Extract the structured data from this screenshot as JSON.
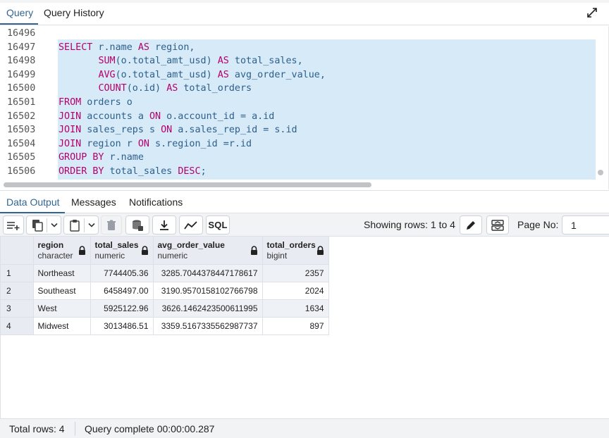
{
  "top_tabs": [
    {
      "label": "Query",
      "active": true
    },
    {
      "label": "Query History",
      "active": false
    }
  ],
  "editor": {
    "line_numbers": [
      "16496",
      "16497",
      "16498",
      "16499",
      "16500",
      "16501",
      "16502",
      "16503",
      "16504",
      "16505",
      "16506"
    ],
    "lines": [
      [],
      [
        {
          "t": "SELECT",
          "k": true
        },
        {
          "t": " r.name "
        },
        {
          "t": "AS",
          "k": true
        },
        {
          "t": " region,"
        }
      ],
      [
        {
          "t": "       "
        },
        {
          "t": "SUM",
          "k": true
        },
        {
          "t": "(o.total_amt_usd) "
        },
        {
          "t": "AS",
          "k": true
        },
        {
          "t": " total_sales,"
        }
      ],
      [
        {
          "t": "       "
        },
        {
          "t": "AVG",
          "k": true
        },
        {
          "t": "(o.total_amt_usd) "
        },
        {
          "t": "AS",
          "k": true
        },
        {
          "t": " avg_order_value,"
        }
      ],
      [
        {
          "t": "       "
        },
        {
          "t": "COUNT",
          "k": true
        },
        {
          "t": "(o.id) "
        },
        {
          "t": "AS",
          "k": true
        },
        {
          "t": " total_orders"
        }
      ],
      [
        {
          "t": "FROM",
          "k": true
        },
        {
          "t": " orders o"
        }
      ],
      [
        {
          "t": "JOIN",
          "k": true
        },
        {
          "t": " accounts a "
        },
        {
          "t": "ON",
          "k": true
        },
        {
          "t": " o.account_id = a.id"
        }
      ],
      [
        {
          "t": "JOIN",
          "k": true
        },
        {
          "t": " sales_reps s "
        },
        {
          "t": "ON",
          "k": true
        },
        {
          "t": " a.sales_rep_id = s.id"
        }
      ],
      [
        {
          "t": "JOIN",
          "k": true
        },
        {
          "t": " region r "
        },
        {
          "t": "ON",
          "k": true
        },
        {
          "t": " s.region_id =r.id"
        }
      ],
      [
        {
          "t": "GROUP BY",
          "k": true
        },
        {
          "t": " r.name"
        }
      ],
      [
        {
          "t": "ORDER BY",
          "k": true
        },
        {
          "t": " total_sales "
        },
        {
          "t": "DESC",
          "k": true
        },
        {
          "t": ";"
        }
      ]
    ]
  },
  "output_tabs": [
    {
      "label": "Data Output",
      "active": true
    },
    {
      "label": "Messages",
      "active": false
    },
    {
      "label": "Notifications",
      "active": false
    }
  ],
  "toolbar": {
    "sql_label": "SQL",
    "showing_rows": "Showing rows: 1 to 4",
    "page_no_label": "Page No:",
    "page_no_value": "1"
  },
  "grid": {
    "columns": [
      {
        "name": "region",
        "type": "character"
      },
      {
        "name": "total_sales",
        "type": "numeric"
      },
      {
        "name": "avg_order_value",
        "type": "numeric"
      },
      {
        "name": "total_orders",
        "type": "bigint"
      }
    ],
    "rows": [
      {
        "num": "1",
        "region": "Northeast",
        "total_sales": "7744405.36",
        "avg_order_value": "3285.7044378447178617",
        "total_orders": "2357"
      },
      {
        "num": "2",
        "region": "Southeast",
        "total_sales": "6458497.00",
        "avg_order_value": "3190.9570158102766798",
        "total_orders": "2024"
      },
      {
        "num": "3",
        "region": "West",
        "total_sales": "5925122.96",
        "avg_order_value": "3626.1462423500611995",
        "total_orders": "1634"
      },
      {
        "num": "4",
        "region": "Midwest",
        "total_sales": "3013486.51",
        "avg_order_value": "3359.5167335562987737",
        "total_orders": "897"
      }
    ]
  },
  "status": {
    "total_rows": "Total rows: 4",
    "query_complete": "Query complete 00:00:00.287"
  },
  "colors": {
    "accent": "#326690",
    "keyword": "#b4006b",
    "identifier": "#2d5f8b",
    "selection": "#d6eaf8"
  }
}
